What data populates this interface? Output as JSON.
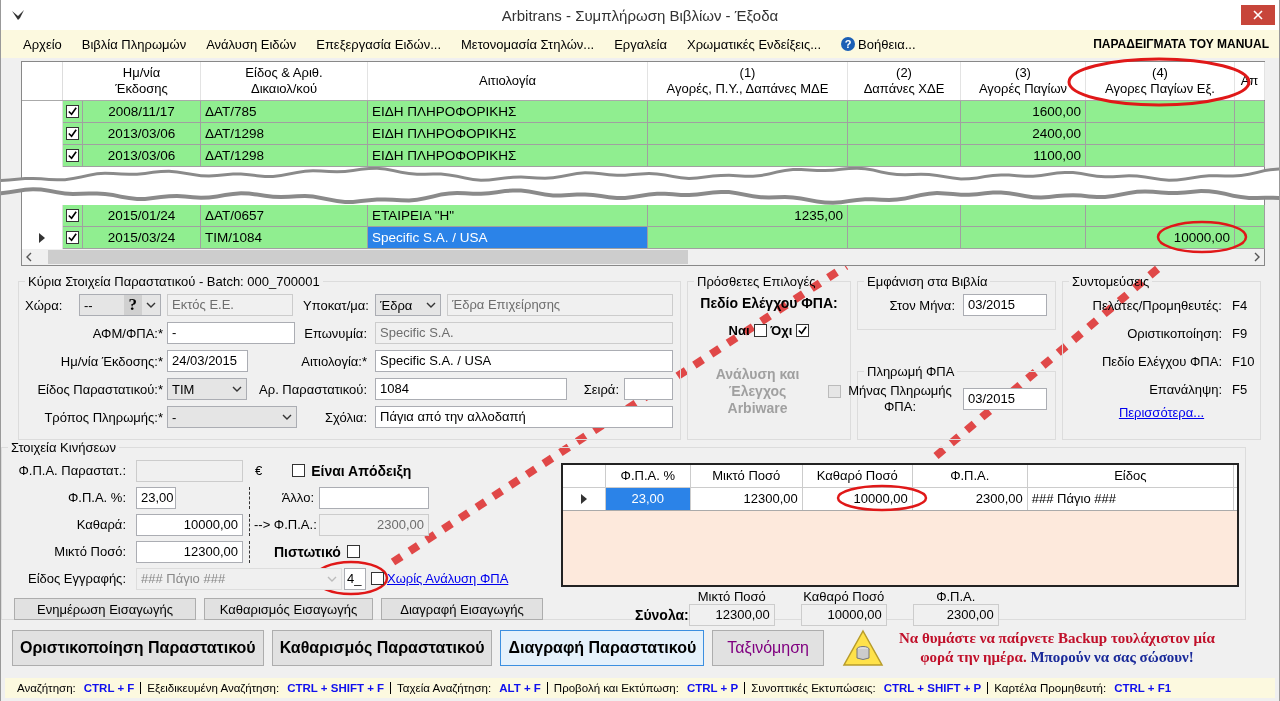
{
  "window": {
    "title": "Arbitrans - Συμπλήρωση Βιβλίων - Έξοδα"
  },
  "menu": {
    "items": [
      {
        "label": "Αρχείο",
        "kind": "plain"
      },
      {
        "label": "Βιβλία Πληρωμών",
        "kind": "plain"
      },
      {
        "label": "Ανάλυση Ειδών",
        "kind": "plain"
      },
      {
        "label": "Επεξεργασία Ειδών...",
        "kind": "plain"
      },
      {
        "label": "Μετονομασία Στηλών...",
        "kind": "plain"
      },
      {
        "label": "Εργαλεία",
        "kind": "plain"
      },
      {
        "label": "Χρωματικές Ενδείξεις...",
        "kind": "plain"
      },
      {
        "label": "Βοήθεια...",
        "kind": "help",
        "icon": "?"
      }
    ],
    "banner": "ΠΑΡΑΔΕΙΓΜΑΤΑ ΤΟΥ MANUAL"
  },
  "grid": {
    "columns": [
      {
        "lines": [
          "Ημ/νία",
          "Έκδοσης"
        ]
      },
      {
        "lines": [
          "Είδος & Αριθ.",
          "Δικαιολ/κού"
        ]
      },
      {
        "lines": [
          "Αιτιολογία"
        ]
      },
      {
        "lines": [
          "(1)",
          "Αγορές, Π.Υ., Δαπάνες ΜΔΕ"
        ]
      },
      {
        "lines": [
          "(2)",
          "Δαπάνες ΧΔΕ"
        ]
      },
      {
        "lines": [
          "(3)",
          "Αγορές Παγίων"
        ]
      },
      {
        "lines": [
          "(4)",
          "Αγορες Παγίων Εξ."
        ]
      },
      {
        "lines": [
          "Απ"
        ]
      }
    ],
    "rows": [
      {
        "kind": "data",
        "current": false,
        "selected": false,
        "checked": true,
        "date": "2008/11/17",
        "document": "ΔΑΤ/785",
        "reason": "ΕΙΔΗ ΠΛΗΡΟΦΟΡΙΚΗΣ",
        "fixed_assets": "1600,00"
      },
      {
        "kind": "data",
        "current": false,
        "selected": false,
        "checked": true,
        "date": "2013/03/06",
        "document": "ΔΑΤ/1298",
        "reason": "ΕΙΔΗ ΠΛΗΡΟΦΟΡΙΚΗΣ",
        "fixed_assets": "2400,00"
      },
      {
        "kind": "data",
        "current": false,
        "selected": false,
        "checked": true,
        "date": "2013/03/06",
        "document": "ΔΑΤ/1298",
        "reason": "ΕΙΔΗ ΠΛΗΡΟΦΟΡΙΚΗΣ",
        "fixed_assets": "1100,00"
      },
      {
        "kind": "torn"
      },
      {
        "kind": "data",
        "current": false,
        "selected": false,
        "checked": true,
        "date": "2015/01/24",
        "document": "ΔΑΤ/0657",
        "reason": "ΕΤΑΙΡΕΙΑ \"Η\"",
        "purchases": "1235,00"
      },
      {
        "kind": "data",
        "current": true,
        "selected": true,
        "checked": true,
        "date": "2015/03/24",
        "document": "ΤΙΜ/1084",
        "reason": "Specific S.A. / USA",
        "fixed_assets_abroad": "10000,00"
      }
    ]
  },
  "main": {
    "title": "Κύρια Στοιχεία Παραστατικού - Batch: 000_700001",
    "rows": [
      {
        "fields": [
          {
            "label": "Χώρα:",
            "kind": "select",
            "value": "--",
            "icon": "?"
          },
          {
            "kind": "readonly",
            "value": "Εκτός Ε.Ε."
          },
          {
            "label": "Υποκατ/μα:",
            "kind": "select",
            "value": "Έδρα"
          },
          {
            "kind": "readonly",
            "value": "Έδρα Επιχείρησης"
          }
        ]
      },
      {
        "fields": [
          {
            "label": "ΑΦΜ/ΦΠΑ:*",
            "kind": "input",
            "value": "-"
          },
          {
            "label": "Επωνυμία:",
            "kind": "readonly",
            "value": "Specific S.A."
          }
        ]
      },
      {
        "fields": [
          {
            "label": "Ημ/νία Έκδοσης:*",
            "kind": "input",
            "value": "24/03/2015"
          },
          {
            "label": "Αιτιολογία:*",
            "kind": "input",
            "value": "Specific S.A. / USA"
          }
        ]
      },
      {
        "fields": [
          {
            "label": "Είδος Παραστατικού:*",
            "kind": "select",
            "value": "ΤΙΜ"
          },
          {
            "label": "Αρ. Παραστατικού:",
            "kind": "input",
            "value": "1084"
          },
          {
            "label": "Σειρά:",
            "kind": "input"
          }
        ]
      },
      {
        "fields": [
          {
            "label": "Τρόπος Πληρωμής:*",
            "kind": "select",
            "value": "-"
          },
          {
            "label": "Σχόλια:",
            "kind": "input",
            "value": "Πάγια από την αλλοδαπή"
          }
        ]
      }
    ]
  },
  "extra": {
    "title": "Πρόσθετες Επιλογές",
    "vat_field": "Πεδίο Ελέγχου ΦΠΑ:",
    "options": [
      {
        "label": "Ναι",
        "checked": false
      },
      {
        "label": "Όχι",
        "checked": true
      }
    ],
    "arbiware": {
      "label": "Ανάλυση και Έλεγχος Arbiware",
      "checked": false,
      "disabled": true
    }
  },
  "books": {
    "title": "Εμφάνιση στα Βιβλία",
    "label": "Στον Μήνα:",
    "value": "03/2015"
  },
  "vat_payment": {
    "title": "Πληρωμή ΦΠΑ",
    "label": "Μήνας Πληρωμής ΦΠΑ:",
    "value": "03/2015"
  },
  "shortcuts": {
    "title": "Συντομεύσεις",
    "items": [
      {
        "action": "Πελάτες/Προμηθευτές:",
        "key": "F4"
      },
      {
        "action": "Οριστικοποίηση:",
        "key": "F9"
      },
      {
        "action": "Πεδίο Ελέγχου ΦΠΑ:",
        "key": "F10"
      },
      {
        "action": "Επανάληψη:",
        "key": "F5"
      }
    ],
    "more": "Περισσότερα..."
  },
  "movements": {
    "title": "Στοιχεία Κινήσεων",
    "document_vat": {
      "label": "Φ.Π.Α. Παραστατ.:",
      "currency": "€"
    },
    "receipt": {
      "label": "Είναι Απόδειξη",
      "checked": false
    },
    "vat_percent": {
      "label": "Φ.Π.Α. %:",
      "value": "23,00"
    },
    "other": {
      "label": "Άλλο:"
    },
    "net": {
      "label": "Καθαρά:",
      "value": "10000,00"
    },
    "vat_amount": {
      "label": "--> Φ.Π.Α.:",
      "value": "2300,00"
    },
    "gross": {
      "label": "Μικτό Ποσό:",
      "value": "12300,00"
    },
    "credit": {
      "label": "Πιστωτικό",
      "checked": false
    },
    "entry_type": {
      "label": "Είδος Εγγραφής:",
      "value": "### Πάγιο ###",
      "code": "4_",
      "no_vat_checked": false,
      "no_vat_link": "Χωρίς Ανάλυση ΦΠΑ"
    },
    "buttons": [
      "Ενημέρωση Εισαγωγής",
      "Καθαρισμός Εισαγωγής",
      "Διαγραφή Εισαγωγής"
    ],
    "lines": {
      "columns": [
        "Φ.Π.Α. %",
        "Μικτό Ποσό",
        "Καθαρό Ποσό",
        "Φ.Π.Α.",
        "Είδος"
      ],
      "rows": [
        {
          "current": true,
          "selected": true,
          "cells": [
            "23,00",
            "12300,00",
            "10000,00",
            "2300,00",
            "### Πάγιο ###"
          ]
        }
      ]
    },
    "totals": {
      "label": "Σύνολα:",
      "items": [
        {
          "label": "Μικτό Ποσό",
          "value": "12300,00"
        },
        {
          "label": "Καθαρό Ποσό",
          "value": "10000,00"
        },
        {
          "label": "Φ.Π.Α.",
          "value": "2300,00"
        }
      ]
    }
  },
  "actions": [
    {
      "label": "Οριστικοποίηση Παραστατικού",
      "kind": "plain",
      "focused": false
    },
    {
      "label": "Καθαρισμός Παραστατικού",
      "kind": "plain",
      "focused": false
    },
    {
      "label": "Διαγραφή Παραστατικού",
      "kind": "plain",
      "focused": true
    },
    {
      "label": "Ταξινόμηση",
      "kind": "accent",
      "focused": false
    }
  ],
  "backup_note": {
    "warning": "Να θυμάστε να παίρνετε Backup τουλάχιστον μία φορά την ημέρα.",
    "encouragement": "Μπορούν να σας σώσουν!"
  },
  "status_bar": [
    {
      "label": "Αναζήτηση:",
      "keys": "CTRL + F"
    },
    {
      "label": "Εξειδικευμένη Αναζήτηση:",
      "keys": "CTRL + SHIFT + F"
    },
    {
      "label": "Ταχεία Αναζήτηση:",
      "keys": "ALT + F"
    },
    {
      "label": "Προβολή και Εκτύπωση:",
      "keys": "CTRL + P"
    },
    {
      "label": "Συνοπτικές Εκτυπώσεις:",
      "keys": "CTRL + SHIFT + P"
    },
    {
      "label": "Καρτέλα Προμηθευτή:",
      "keys": "CTRL + F1"
    }
  ]
}
